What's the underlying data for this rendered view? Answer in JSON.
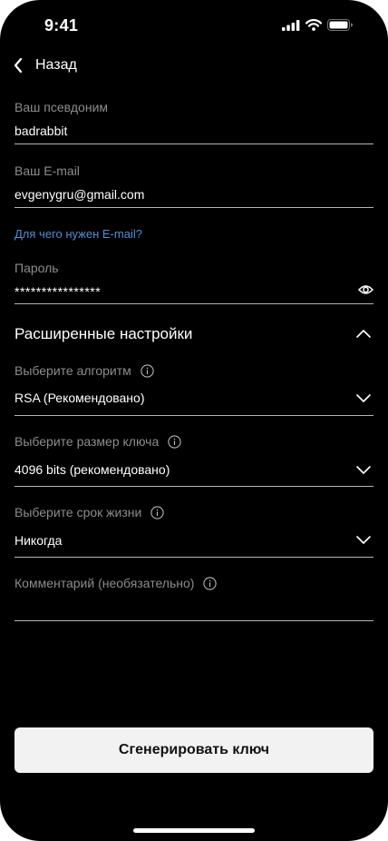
{
  "status_bar": {
    "time": "9:41"
  },
  "nav": {
    "back_label": "Назад"
  },
  "form": {
    "nickname": {
      "label": "Ваш псевдоним",
      "value": "badrabbit"
    },
    "email": {
      "label": "Ваш E-mail",
      "value": "evgenygru@gmail.com"
    },
    "email_help_link": "Для чего нужен E-mail?",
    "password": {
      "label": "Пароль",
      "value": "****************"
    }
  },
  "advanced": {
    "title": "Расширенные настройки",
    "algorithm": {
      "label": "Выберите алгоритм",
      "value": "RSA (Рекомендовано)"
    },
    "key_size": {
      "label": "Выберите размер ключа",
      "value": "4096 bits (рекомендовано)"
    },
    "lifetime": {
      "label": "Выберите срок жизни",
      "value": "Никогда"
    },
    "comment": {
      "label": "Комментарий (необязательно)",
      "value": ""
    }
  },
  "generate_button": "Сгенерировать ключ",
  "icons": [
    "signal-icon",
    "wifi-icon",
    "battery-icon",
    "chevron-left-icon",
    "eye-icon",
    "chevron-up-icon",
    "info-icon",
    "chevron-down-icon"
  ],
  "colors": {
    "background": "#000000",
    "link": "#4e8fd8",
    "label": "#8c8c8c",
    "button_bg": "#f2f2f2"
  }
}
